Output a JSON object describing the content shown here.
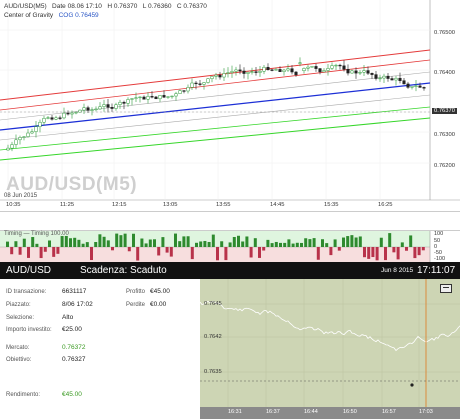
{
  "chart": {
    "symbol": "AUD/USD(M5)",
    "date_line": "Date 08.06 17:10",
    "open": "AUD/USD(M5) ",
    "ohlc": {
      "h": "H 0.76370",
      "l": "L 0.76360",
      "c": "C 0.76370"
    },
    "cog_label": "Center of Gravity",
    "cog_value": "COG 0.76459",
    "date_label": "08 Jun 2015",
    "price_axis": [
      "0.76500",
      "0.76400",
      "0.76300",
      "0.76200"
    ],
    "current_price": "0.76370",
    "time_axis": [
      "10:35",
      "11:25",
      "12:15",
      "13:05",
      "13:55",
      "14:45",
      "15:35",
      "16:25"
    ],
    "colors": {
      "red": "#e43a3a",
      "blue": "#1c2fd6",
      "green": "#36d62a",
      "gray": "#aaaaaa",
      "candle": "#2e9a3a"
    }
  },
  "timing": {
    "label": "Timing — Timing 100.00",
    "axis": [
      "100",
      "50",
      "0",
      "-50",
      "-100"
    ]
  },
  "panel": {
    "symbol": "AUD/USD",
    "expiry": "Scadenza: Scaduto",
    "date": "Jun 8 2015",
    "time": "17:11:07",
    "fields": {
      "trans_id_label": "ID transazione:",
      "trans_id_value": "6631117",
      "placed_label": "Piazzato:",
      "placed_value": "8/06 17:02",
      "selection_label": "Selezione:",
      "selection_value": "Alto",
      "investment_label": "Importo investito:",
      "investment_value": "€25.00",
      "profit_label": "Profitto",
      "profit_value": "€45.00",
      "loss_label": "Perdite",
      "loss_value": "€0.00",
      "market_label": "Mercato:",
      "market_value": "0.76372",
      "target_label": "Obiettivo:",
      "target_value": "0.76327",
      "yield_label": "Rendimento:",
      "yield_value": "€45.00"
    },
    "mini_chart": {
      "y_axis": [
        "0.7645",
        "0.7642",
        "0.7635"
      ],
      "x_axis": [
        "16:31",
        "16:37",
        "16:44",
        "16:50",
        "16:57",
        "17:03"
      ]
    }
  }
}
